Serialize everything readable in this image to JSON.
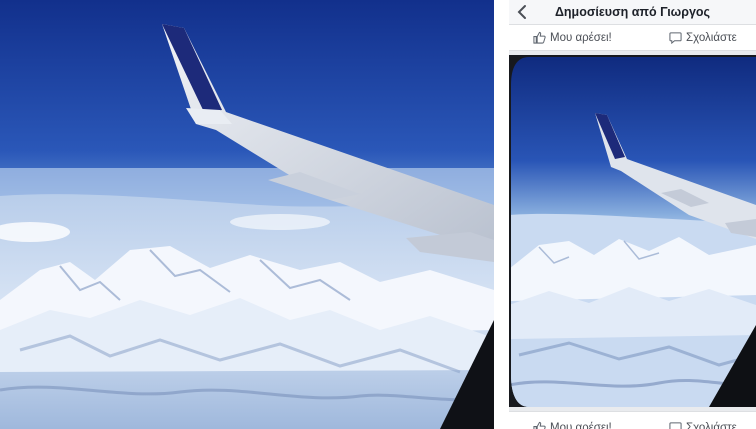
{
  "header": {
    "title": "Δημοσίευση από Γιωργος"
  },
  "actions": {
    "like_label": "Μου αρέσει!",
    "comment_label": "Σχολιάστε"
  },
  "colors": {
    "sky_top": "#1c3e9e",
    "sky_horizon": "#9cc2e8",
    "snow": "#eef3fb",
    "wing": "#dfe4ec",
    "winglet": "#1d2a7a",
    "panel_bg": "#e9ebee",
    "text": "#4b4f56"
  },
  "icons": {
    "back": "chevron-left-icon",
    "like": "thumbs-up-icon",
    "comment": "comment-bubble-icon"
  }
}
